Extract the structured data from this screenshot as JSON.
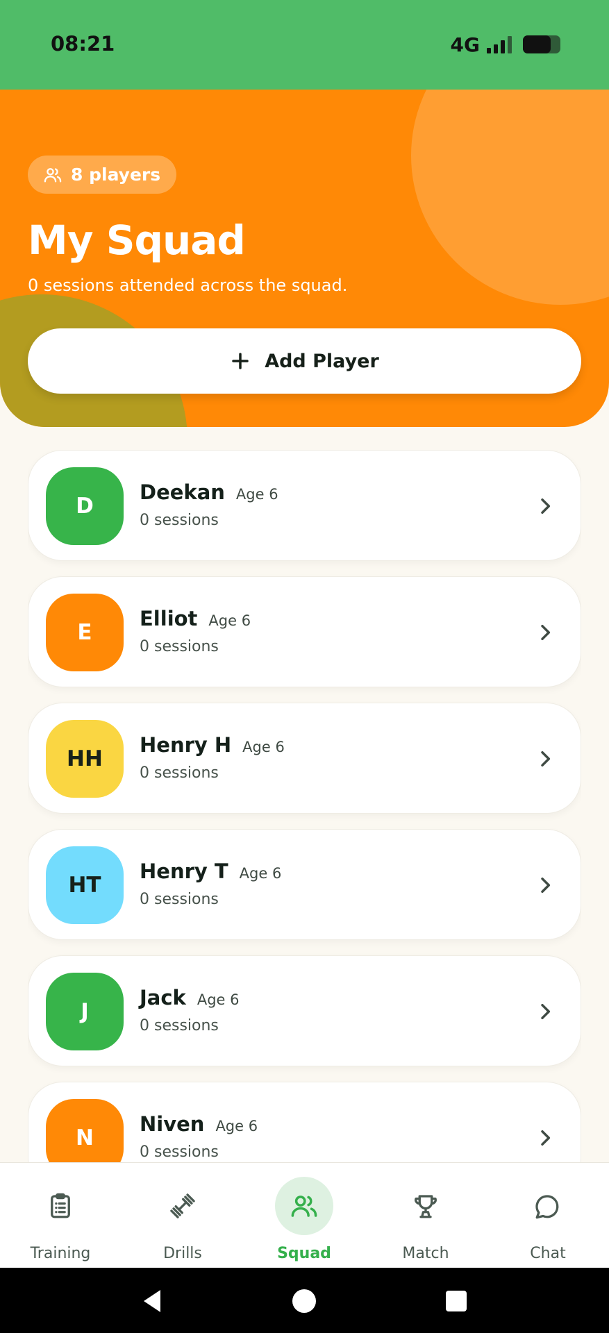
{
  "status_bar": {
    "time": "08:21",
    "network": "4G"
  },
  "header": {
    "players_badge": "8 players",
    "title": "My Squad",
    "subtitle": "0 sessions attended across the squad.",
    "add_button": "Add Player",
    "colors": {
      "background": "#ff8906",
      "circle_light": "#ff9e32",
      "circle_dark": "#b39c20"
    }
  },
  "players": [
    {
      "initials": "D",
      "name": "Deekan",
      "age": "Age 6",
      "sessions": "0 sessions",
      "color": "#37b44a",
      "text_color": "#ffffff"
    },
    {
      "initials": "E",
      "name": "Elliot",
      "age": "Age 6",
      "sessions": "0 sessions",
      "color": "#ff8906",
      "text_color": "#ffffff"
    },
    {
      "initials": "HH",
      "name": "Henry H",
      "age": "Age 6",
      "sessions": "0 sessions",
      "color": "#fad642",
      "text_color": "#17211a"
    },
    {
      "initials": "HT",
      "name": "Henry T",
      "age": "Age 6",
      "sessions": "0 sessions",
      "color": "#73dcfd",
      "text_color": "#17211a"
    },
    {
      "initials": "J",
      "name": "Jack",
      "age": "Age 6",
      "sessions": "0 sessions",
      "color": "#37b44a",
      "text_color": "#ffffff"
    },
    {
      "initials": "N",
      "name": "Niven",
      "age": "Age 6",
      "sessions": "0 sessions",
      "color": "#ff8906",
      "text_color": "#ffffff"
    }
  ],
  "bottom_nav": {
    "items": [
      {
        "label": "Training",
        "icon": "clipboard-icon"
      },
      {
        "label": "Drills",
        "icon": "dumbbell-icon"
      },
      {
        "label": "Squad",
        "icon": "users-icon",
        "active": true
      },
      {
        "label": "Match",
        "icon": "trophy-icon"
      },
      {
        "label": "Chat",
        "icon": "chat-bubble-icon"
      }
    ],
    "active_color": "#35b04c"
  }
}
